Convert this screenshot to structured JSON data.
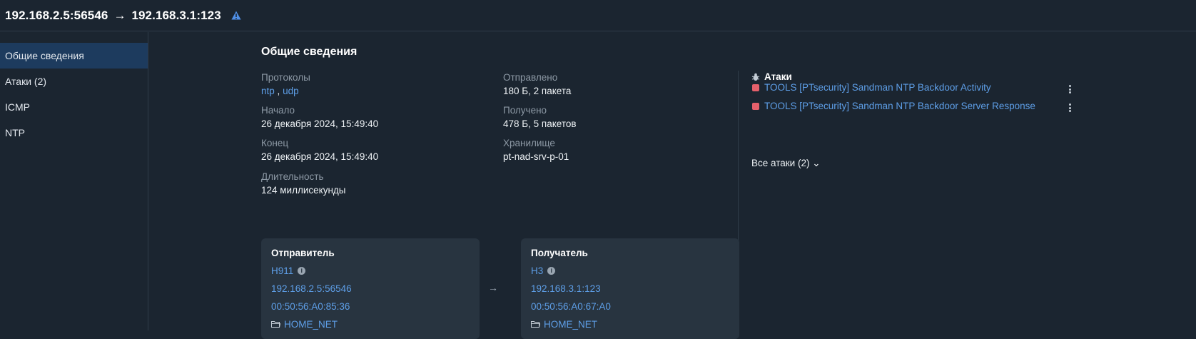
{
  "header": {
    "source": "192.168.2.5:56546",
    "arrow": "→",
    "destination": "192.168.3.1:123",
    "warning_icon": "warning-triangle-icon"
  },
  "sidebar": {
    "items": [
      {
        "label": "Общие сведения",
        "active": true
      },
      {
        "label": "Атаки (2)"
      },
      {
        "label": "ICMP"
      },
      {
        "label": "NTP"
      }
    ]
  },
  "main": {
    "title": "Общие сведения",
    "protocols": {
      "label": "Протоколы",
      "values": [
        "ntp",
        "udp"
      ],
      "sep": ","
    },
    "start": {
      "label": "Начало",
      "value": "26 декабря 2024, 15:49:40"
    },
    "end": {
      "label": "Конец",
      "value": "26 декабря 2024, 15:49:40"
    },
    "duration": {
      "label": "Длительность",
      "value": "124 миллисекунды"
    },
    "sent": {
      "label": "Отправлено",
      "value": "180 Б, 2 пакета"
    },
    "received": {
      "label": "Получено",
      "value": "478 Б, 5 пакетов"
    },
    "storage": {
      "label": "Хранилище",
      "value": "pt-nad-srv-p-01"
    }
  },
  "attacks": {
    "title": "Атаки",
    "icon": "bug-icon",
    "items": [
      {
        "name": "TOOLS [PTsecurity] Sandman NTP Backdoor Activity",
        "color": "#e5606b"
      },
      {
        "name": "TOOLS [PTsecurity] Sandman NTP Backdoor Server Response",
        "color": "#e5606b"
      }
    ],
    "all_label": "Все атаки (2)",
    "chevron": "⌄"
  },
  "sender": {
    "title": "Отправитель",
    "host": "H911",
    "ip": "192.168.2.5",
    "port": ":56546",
    "mac": "00:50:56:A0:85:36",
    "net": "HOME_NET"
  },
  "receiver": {
    "title": "Получатель",
    "host": "H3",
    "ip": "192.168.3.1",
    "port": ":123",
    "mac": "00:50:56:A0:67:A0",
    "net": "HOME_NET"
  },
  "flow_arrow": "→",
  "colors": {
    "accent": "#5e9fe8",
    "background": "#1b2530",
    "active_nav": "#1d3b5e",
    "card": "#283440",
    "attack_marker": "#e5606b"
  }
}
